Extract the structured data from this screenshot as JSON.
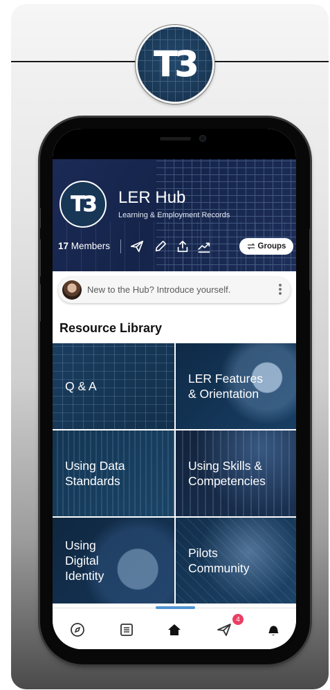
{
  "brand": {
    "logo_text": "T3",
    "colors": {
      "primary": "#1b2a55",
      "accent": "#4f92d4",
      "badge": "#ea3f63"
    }
  },
  "header": {
    "title": "LER Hub",
    "subtitle": "Learning & Employment Records",
    "member_count": "17",
    "members_label": "Members",
    "icons": [
      "send-icon",
      "edit-icon",
      "share-icon",
      "analytics-icon"
    ],
    "groups_button_label": "Groups"
  },
  "intro_prompt": {
    "text": "New to the Hub? Introduce yourself."
  },
  "resource_library": {
    "title": "Resource Library",
    "tiles": [
      {
        "label": "Q & A"
      },
      {
        "label": "LER Features & Orientation"
      },
      {
        "label": "Using Data Standards"
      },
      {
        "label": "Using Skills & Competencies"
      },
      {
        "label": "Using Digital Identity"
      },
      {
        "label": "Pilots Community"
      }
    ]
  },
  "bottom_nav": {
    "items": [
      "compass-icon",
      "feed-icon",
      "home-icon",
      "messages-icon",
      "notifications-icon"
    ],
    "active": "home-icon",
    "messages_badge": "4"
  }
}
